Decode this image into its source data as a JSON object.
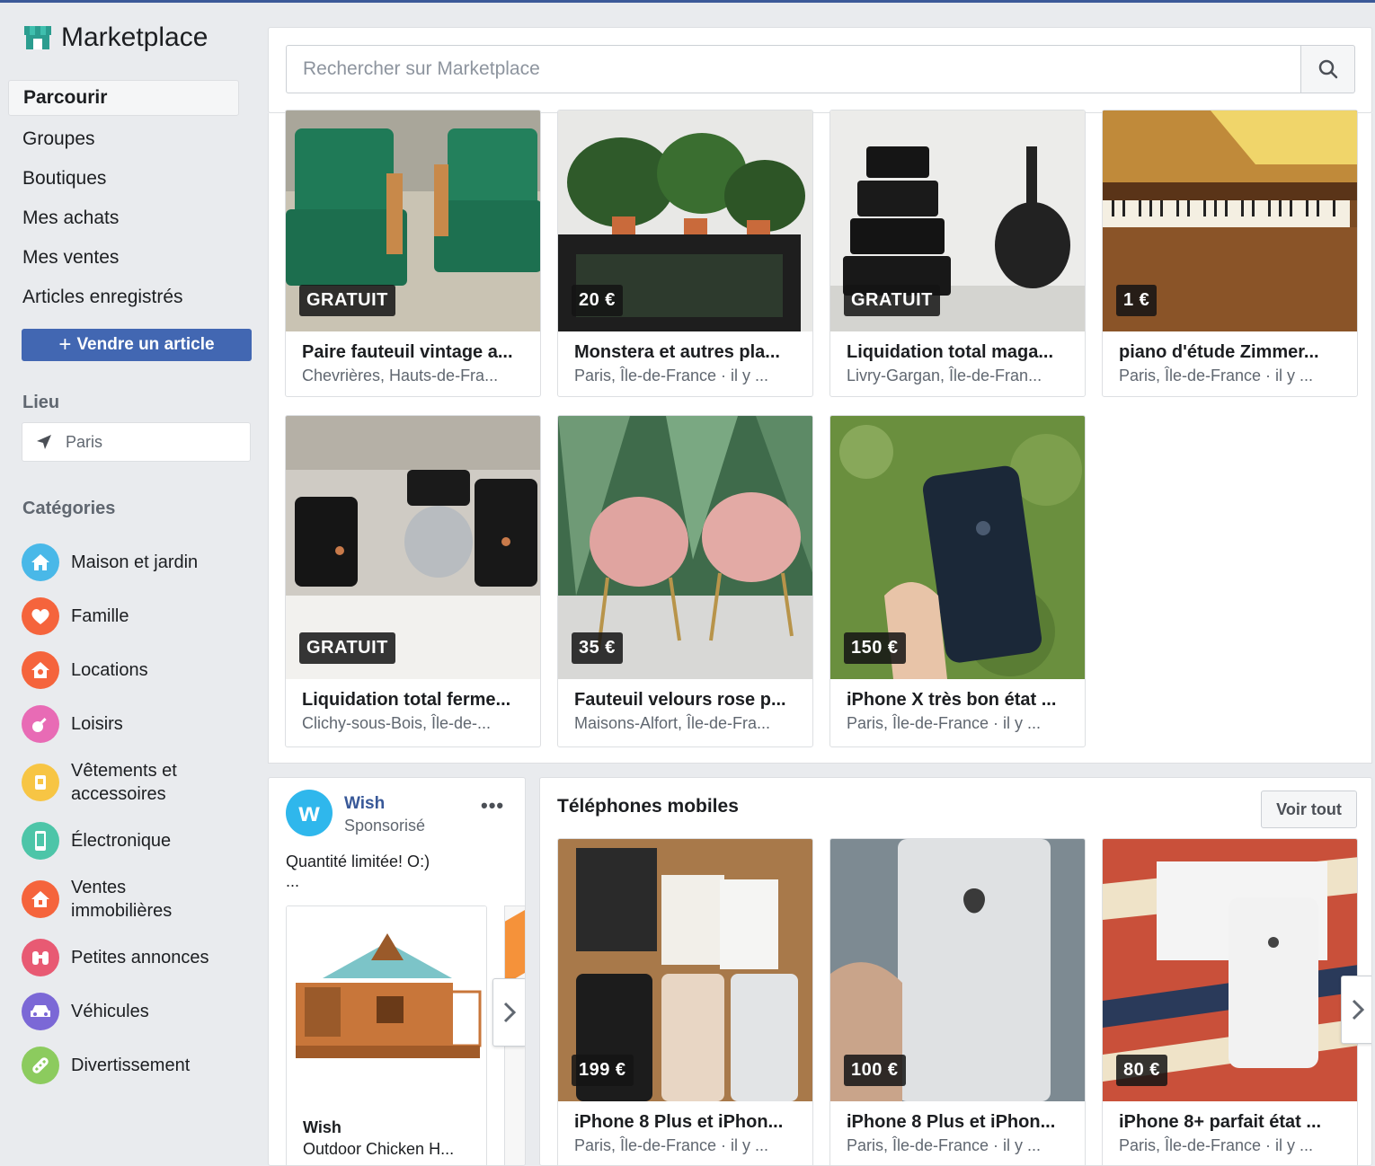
{
  "app": {
    "title": "Marketplace"
  },
  "nav": {
    "items": [
      {
        "label": "Parcourir"
      },
      {
        "label": "Groupes"
      },
      {
        "label": "Boutiques"
      },
      {
        "label": "Mes achats"
      },
      {
        "label": "Mes ventes"
      },
      {
        "label": "Articles enregistrés"
      }
    ],
    "sell_label": "Vendre un article"
  },
  "location": {
    "title": "Lieu",
    "value": "Paris"
  },
  "categories": {
    "title": "Catégories",
    "items": [
      {
        "label": "Maison et jardin",
        "color": "#49b8e8",
        "icon": "home-icon"
      },
      {
        "label": "Famille",
        "color": "#f5643c",
        "icon": "heart-icon"
      },
      {
        "label": "Locations",
        "color": "#f5643c",
        "icon": "house-key-icon"
      },
      {
        "label": "Loisirs",
        "color": "#e86bb5",
        "icon": "guitar-icon"
      },
      {
        "label": "Vêtements et accessoires",
        "color": "#f7c544",
        "icon": "shirt-icon"
      },
      {
        "label": "Électronique",
        "color": "#4dc5a8",
        "icon": "phone-icon"
      },
      {
        "label": "Ventes immobilières",
        "color": "#f5643c",
        "icon": "house-icon"
      },
      {
        "label": "Petites annonces",
        "color": "#e85a73",
        "icon": "binoculars-icon"
      },
      {
        "label": "Véhicules",
        "color": "#7b68d6",
        "icon": "car-icon"
      },
      {
        "label": "Divertissement",
        "color": "#8ccb5e",
        "icon": "link-icon"
      }
    ]
  },
  "search": {
    "placeholder": "Rechercher sur Marketplace"
  },
  "listings": [
    {
      "price": "GRATUIT",
      "title": "Paire fauteuil vintage a...",
      "location": "Chevrières, Hauts-de-Fra..."
    },
    {
      "price": "20 €",
      "title": "Monstera et autres pla...",
      "location": "Paris, Île-de-France · il y ..."
    },
    {
      "price": "GRATUIT",
      "title": "Liquidation total maga...",
      "location": "Livry-Gargan, Île-de-Fran..."
    },
    {
      "price": "1 €",
      "title": "piano d'étude Zimmer...",
      "location": "Paris, Île-de-France · il y ..."
    },
    {
      "price": "GRATUIT",
      "title": "Liquidation total ferme...",
      "location": "Clichy-sous-Bois, Île-de-..."
    },
    {
      "price": "35 €",
      "title": "Fauteuil velours rose p...",
      "location": "Maisons-Alfort, Île-de-Fra..."
    },
    {
      "price": "150 €",
      "title": "iPhone X très bon état ...",
      "location": "Paris, Île-de-France · il y ..."
    }
  ],
  "ad": {
    "brand": "Wish",
    "sponsored": "Sponsorisé",
    "text": "Quantité limitée! O:)",
    "ellipsis": "...",
    "item_brand": "Wish",
    "item_title": "Outdoor Chicken H..."
  },
  "phones": {
    "title": "Téléphones mobiles",
    "see_all": "Voir tout",
    "items": [
      {
        "price": "199 €",
        "title": "iPhone 8 Plus et iPhon...",
        "location": "Paris, Île-de-France · il y ..."
      },
      {
        "price": "100 €",
        "title": "iPhone 8 Plus et iPhon...",
        "location": "Paris, Île-de-France · il y ..."
      },
      {
        "price": "80 €",
        "title": "iPhone 8+ parfait état ...",
        "location": "Paris, Île-de-France · il y ..."
      }
    ]
  }
}
